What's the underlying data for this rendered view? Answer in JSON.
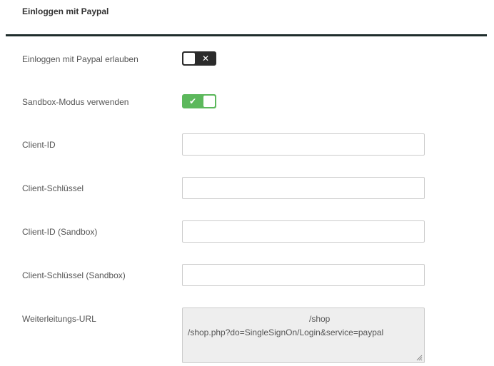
{
  "section": {
    "title": "Einloggen mit Paypal"
  },
  "fields": {
    "allow_paypal_login": {
      "label": "Einloggen mit Paypal erlauben",
      "toggle_state": "off",
      "toggle_glyph": "✕"
    },
    "sandbox_mode": {
      "label": "Sandbox-Modus verwenden",
      "toggle_state": "on",
      "toggle_glyph": "✔"
    },
    "client_id": {
      "label": "Client-ID",
      "value": ""
    },
    "client_secret": {
      "label": "Client-Schlüssel",
      "value": ""
    },
    "client_id_sandbox": {
      "label": "Client-ID (Sandbox)",
      "value": ""
    },
    "client_secret_sandbox": {
      "label": "Client-Schlüssel (Sandbox)",
      "value": ""
    },
    "redirect_url": {
      "label": "Weiterleitungs-URL",
      "value_line1": "/shop",
      "value_line2": "/shop.php?do=SingleSignOn/Login&service=paypal"
    }
  },
  "colors": {
    "toggle_off": "#2b2b2b",
    "toggle_on": "#5cb85c",
    "divider": "#1f2d2c",
    "readonly_bg": "#eeeeee"
  }
}
